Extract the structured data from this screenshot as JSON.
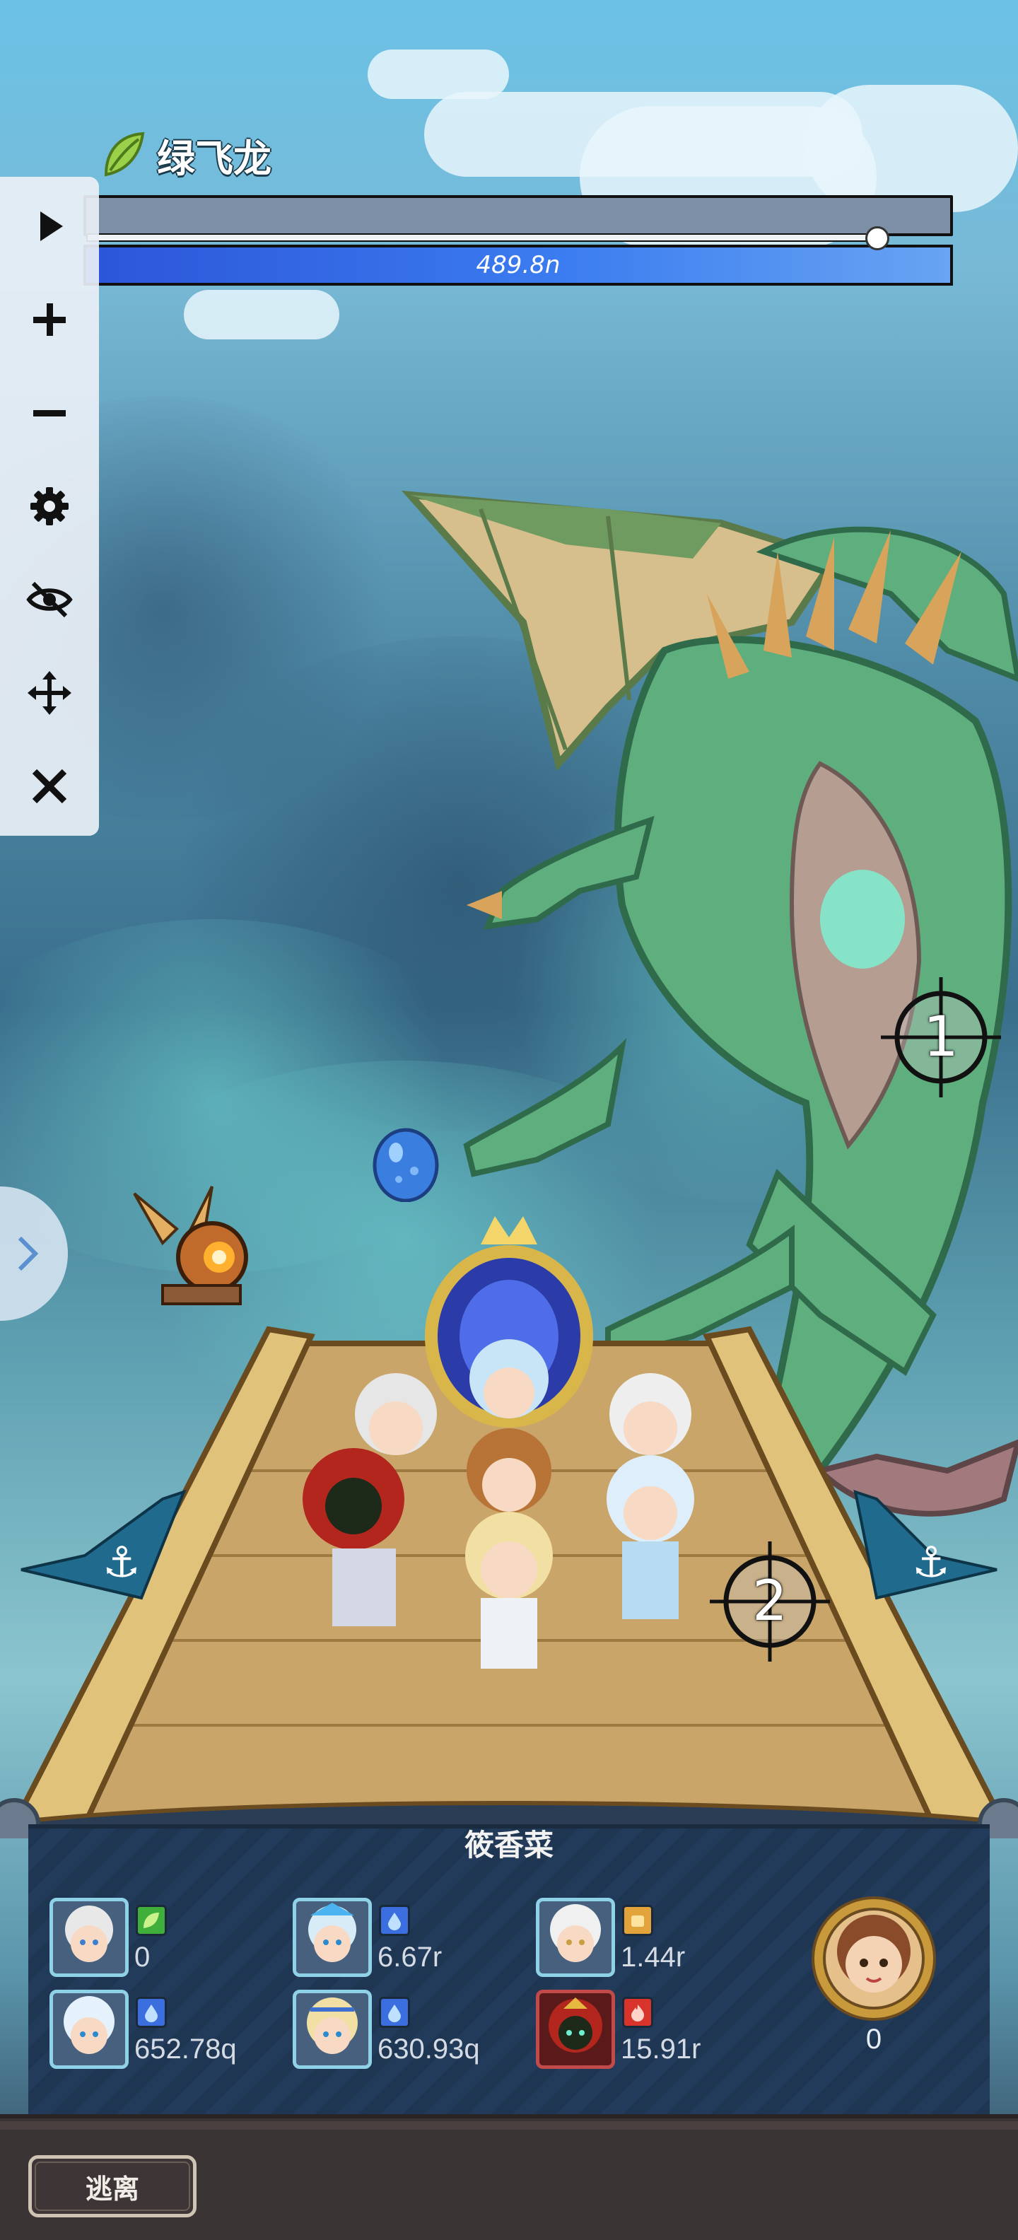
{
  "boss": {
    "name": "绿飞龙",
    "shield_value": "489.8n",
    "hp_fraction": 1.0
  },
  "toolbar": {
    "items": [
      {
        "name": "play-icon"
      },
      {
        "name": "plus-icon"
      },
      {
        "name": "minus-icon"
      },
      {
        "name": "gear-icon"
      },
      {
        "name": "eye-off-icon"
      },
      {
        "name": "move-icon"
      },
      {
        "name": "close-icon"
      }
    ]
  },
  "targets": [
    {
      "label": "1"
    },
    {
      "label": "2"
    }
  ],
  "panel": {
    "title": "筱香菜",
    "heroes": [
      {
        "element": "wind",
        "badge_color": "#3fae3a",
        "damage": "0"
      },
      {
        "element": "water",
        "badge_color": "#3b6fe0",
        "damage": "6.67r"
      },
      {
        "element": "earth",
        "badge_color": "#e2a43a",
        "damage": "1.44r"
      },
      {
        "element": "water",
        "badge_color": "#3b6fe0",
        "damage": "652.78q"
      },
      {
        "element": "water",
        "badge_color": "#3b6fe0",
        "damage": "630.93q"
      },
      {
        "element": "fire",
        "badge_color": "#d8342c",
        "damage": "15.91r"
      }
    ],
    "captain_count": "0"
  },
  "footer": {
    "escape_label": "逃离"
  }
}
